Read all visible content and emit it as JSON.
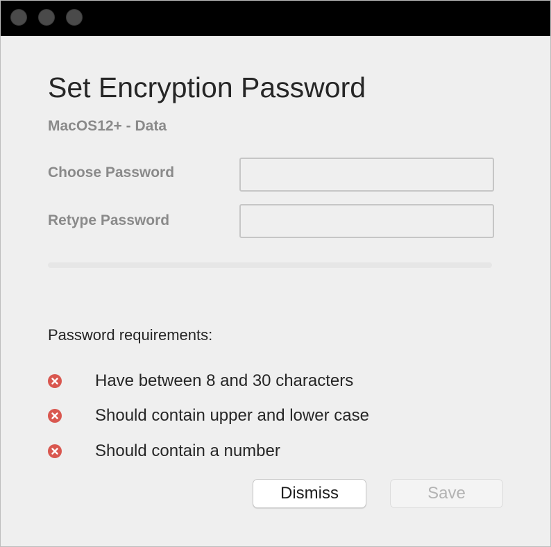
{
  "window": {
    "title": "Set Encryption Password",
    "subtitle": "MacOS12+ - Data"
  },
  "form": {
    "choose_password": {
      "label": "Choose Password",
      "value": "",
      "placeholder": ""
    },
    "retype_password": {
      "label": "Retype Password",
      "value": "",
      "placeholder": ""
    },
    "strength": {
      "level": 0
    }
  },
  "requirements": {
    "heading": "Password requirements:",
    "items": [
      {
        "text": "Have between 8 and 30 characters",
        "met": false,
        "icon": "x-circle-icon"
      },
      {
        "text": "Should contain upper and lower case",
        "met": false,
        "icon": "x-circle-icon"
      },
      {
        "text": "Should contain a number",
        "met": false,
        "icon": "x-circle-icon"
      }
    ]
  },
  "buttons": {
    "dismiss_label": "Dismiss",
    "save_label": "Save",
    "save_enabled": false
  },
  "colors": {
    "titlebar": "#000000",
    "error": "#d9574f",
    "text_primary": "#262626",
    "text_secondary": "#8a8a8a"
  }
}
